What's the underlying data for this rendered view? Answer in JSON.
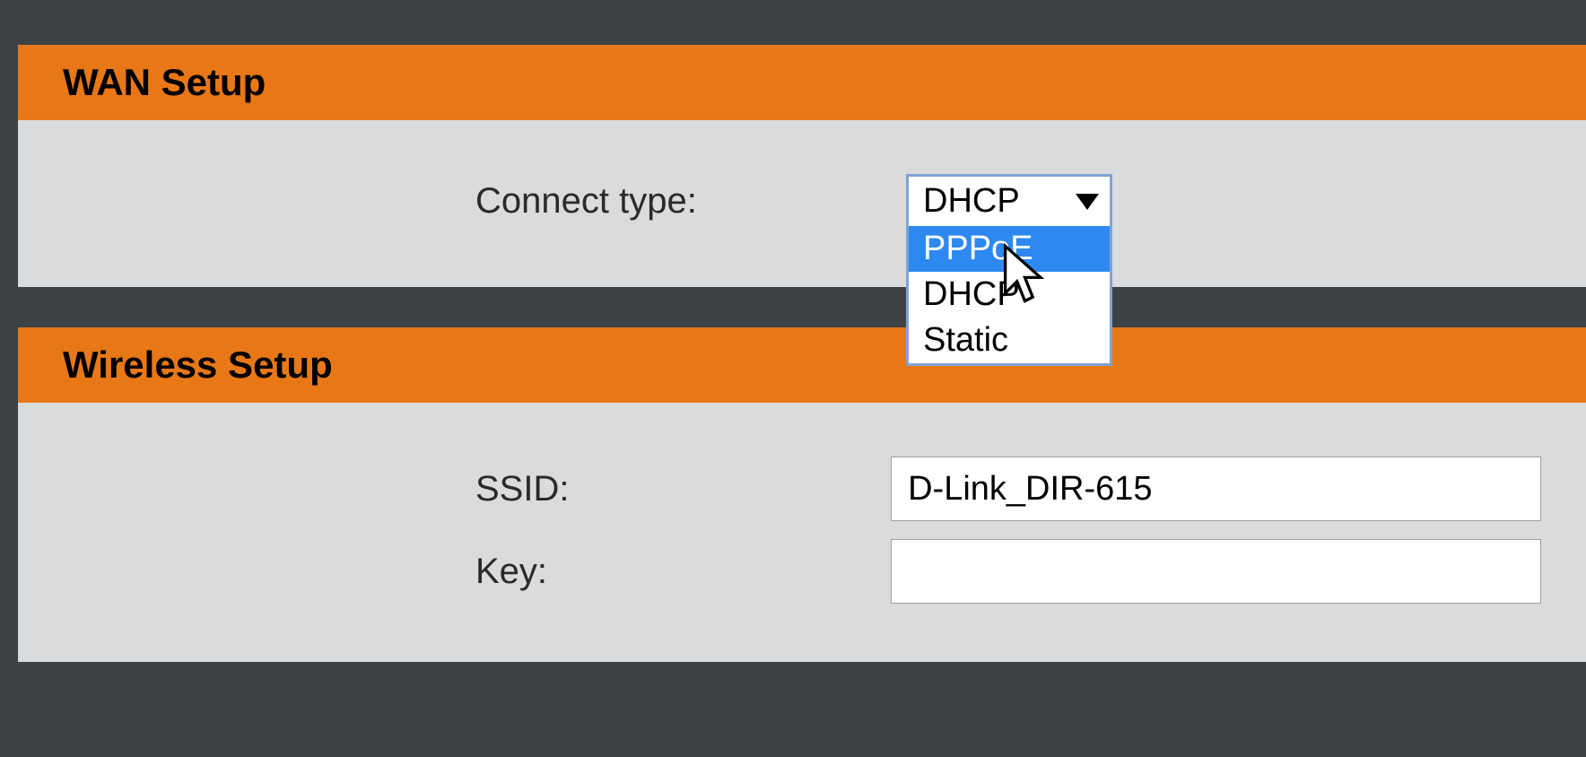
{
  "wan": {
    "title": "WAN Setup",
    "connect_type_label": "Connect type:",
    "connect_type_value": "DHCP",
    "connect_type_options": [
      "PPPoE",
      "DHCP",
      "Static"
    ]
  },
  "wireless": {
    "title": "Wireless Setup",
    "ssid_label": "SSID:",
    "ssid_value": "D-Link_DIR-615",
    "key_label": "Key:",
    "key_value": ""
  },
  "colors": {
    "header_bg": "#e87817",
    "body_bg": "#d9dbdc",
    "page_bg": "#3d4244",
    "select_border": "#7da5d6",
    "highlight": "#2d89ef"
  }
}
